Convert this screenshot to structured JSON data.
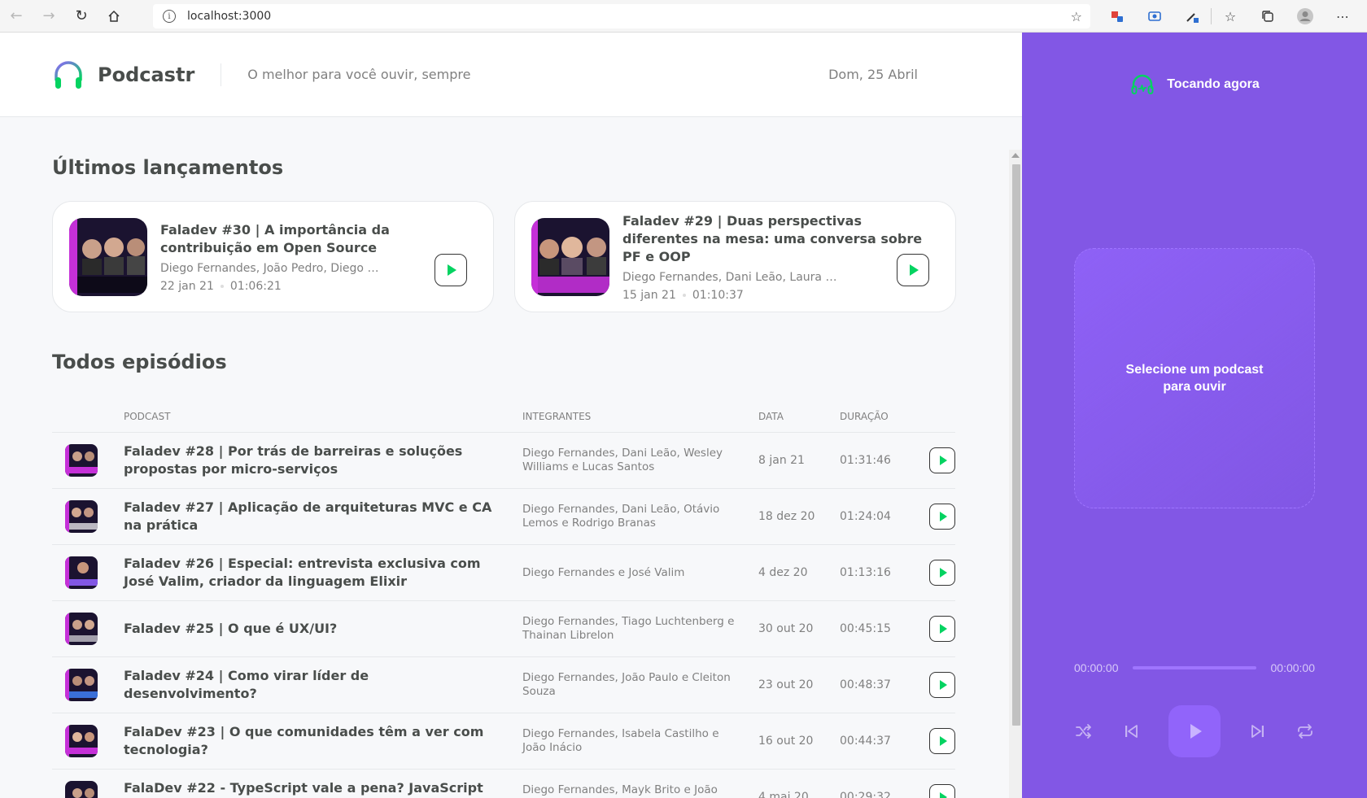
{
  "browser": {
    "url": "localhost:3000"
  },
  "header": {
    "app_name": "Podcastr",
    "tagline": "O melhor para você ouvir, sempre",
    "date": "Dom, 25 Abril"
  },
  "latest": {
    "title": "Últimos lançamentos",
    "episodes": [
      {
        "title": "Faladev #30 | A importância da contribuição em Open Source",
        "members": "Diego Fernandes, João Pedro, Diego H...",
        "published": "22 jan 21",
        "duration": "01:06:21",
        "thumb_caption": "Por que é tão imp contribuir em Open S"
      },
      {
        "title": "Faladev #29 | Duas perspectivas diferentes na mesa: uma conversa sobre PF e OOP",
        "members": "Diego Fernandes, Dani Leão, Laura Beat...",
        "published": "15 jan 21",
        "duration": "01:10:37",
        "thumb_caption": "Programação funcio deve orientados a"
      }
    ]
  },
  "all": {
    "title": "Todos episódios",
    "columns": {
      "podcast": "Podcast",
      "members": "Integrantes",
      "date": "Data",
      "duration": "Duração"
    },
    "episodes": [
      {
        "title": "Faladev #28 | Por trás de barreiras e soluções propostas por micro-serviços",
        "members": "Diego Fernandes, Dani Leão, Wesley Williams e Lucas Santos",
        "date": "8 jan 21",
        "duration": "01:31:46"
      },
      {
        "title": "Faladev #27 | Aplicação de arquiteturas MVC e CA na prática",
        "members": "Diego Fernandes, Dani Leão, Otávio Lemos e Rodrigo Branas",
        "date": "18 dez 20",
        "duration": "01:24:04"
      },
      {
        "title": "Faladev #26 | Especial: entrevista exclusiva com José Valim, criador da linguagem Elixir",
        "members": "Diego Fernandes e José Valim",
        "date": "4 dez 20",
        "duration": "01:13:16"
      },
      {
        "title": "Faladev #25 | O que é UX/UI?",
        "members": "Diego Fernandes, Tiago Luchtenberg e Thainan Librelon",
        "date": "30 out 20",
        "duration": "00:45:15"
      },
      {
        "title": "Faladev #24 | Como virar líder de desenvolvimento?",
        "members": "Diego Fernandes, João Paulo e Cleiton Souza",
        "date": "23 out 20",
        "duration": "00:48:37"
      },
      {
        "title": "FalaDev #23 | O que comunidades têm a ver com tecnologia?",
        "members": "Diego Fernandes, Isabela Castilho e João Inácio",
        "date": "16 out 20",
        "duration": "00:44:37"
      },
      {
        "title": "FalaDev #22 - TypeScript vale a pena? JavaScript perde sentido?",
        "members": "Diego Fernandes, Mayk Brito e João Pedro",
        "date": "4 mai 20",
        "duration": "00:29:32"
      }
    ]
  },
  "player": {
    "title": "Tocando agora",
    "empty_message": "Selecione um podcast para ouvir",
    "current_time": "00:00:00",
    "total_time": "00:00:00"
  },
  "colors": {
    "brand_purple": "#8257e5",
    "accent_green": "#04d361"
  }
}
